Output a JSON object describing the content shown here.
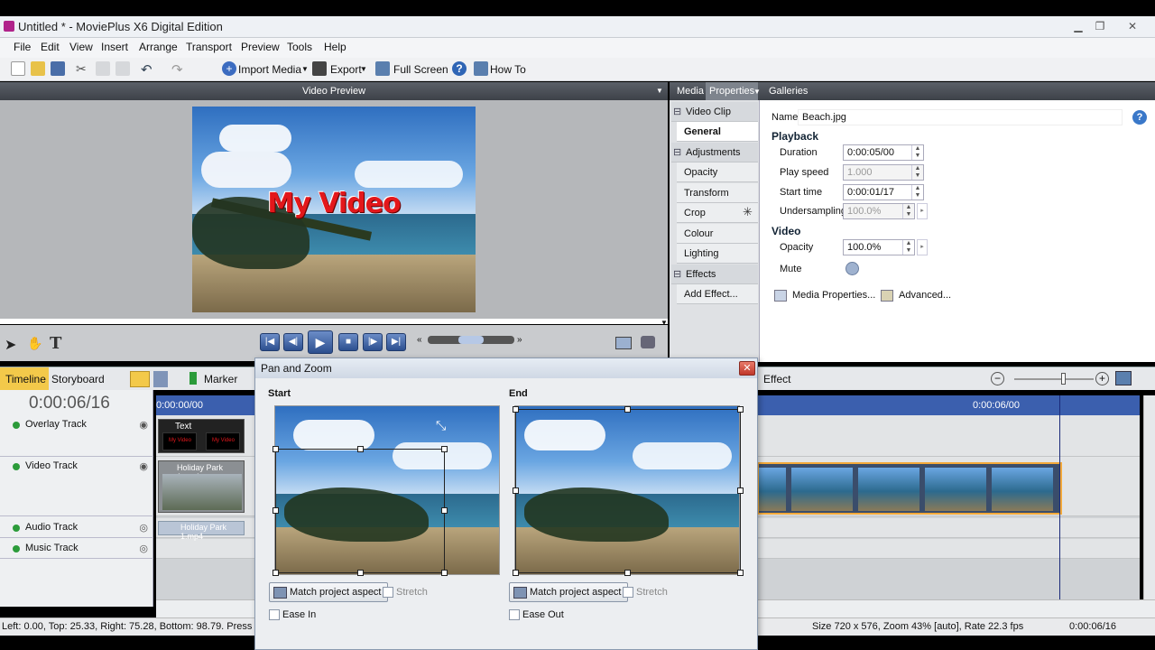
{
  "window": {
    "title": "Untitled * - MoviePlus X6 Digital Edition"
  },
  "menu": [
    "File",
    "Edit",
    "View",
    "Insert",
    "Arrange",
    "Transport",
    "Preview",
    "Tools",
    "Help"
  ],
  "toolbar": {
    "import_label": "Import Media",
    "export_label": "Export",
    "fullscreen_label": "Full Screen",
    "howto_label": "How To"
  },
  "preview": {
    "header": "Video Preview",
    "overlay_title": "My Video"
  },
  "right_panel": {
    "tabs": [
      "Media",
      "Properties",
      "Galleries"
    ],
    "active_tab": "Properties",
    "sidebar": {
      "video_clip": "Video Clip",
      "general": "General",
      "adjustments": "Adjustments",
      "adjust_items": [
        "Opacity",
        "Transform",
        "Crop",
        "Colour",
        "Lighting"
      ],
      "effects": "Effects",
      "add_effect": "Add Effect..."
    },
    "props": {
      "name_label": "Name",
      "name_value": "Beach.jpg",
      "playback_header": "Playback",
      "duration_label": "Duration",
      "duration_value": "0:00:05/00",
      "play_speed_label": "Play speed",
      "play_speed_value": "1.000",
      "start_time_label": "Start time",
      "start_time_value": "0:00:01/17",
      "undersampling_label": "Undersampling",
      "undersampling_value": "100.0%",
      "video_header": "Video",
      "opacity_label": "Opacity",
      "opacity_value": "100.0%",
      "mute_label": "Mute",
      "media_properties": "Media Properties...",
      "advanced": "Advanced..."
    }
  },
  "timeline": {
    "tabs": [
      "Timeline",
      "Storyboard"
    ],
    "marker_label": "Marker",
    "effect_label": "Effect",
    "current_time": "0:00:06/16",
    "ruler_start": "0:00:00/00",
    "ruler_mark": "0:00:06/00",
    "tracks": [
      "Overlay Track",
      "Video Track",
      "Audio Track",
      "Music Track"
    ],
    "overlay_clip_label": "Text",
    "overlay_clip_mini": "My Video",
    "video_clip_label": "Holiday Park 1.mp4",
    "audio_clip_label": "Holiday Park 1.mp4"
  },
  "pan_zoom": {
    "title": "Pan and Zoom",
    "start_label": "Start",
    "end_label": "End",
    "match_aspect": "Match project aspect",
    "stretch": "Stretch",
    "ease_in": "Ease In",
    "ease_out": "Ease Out"
  },
  "status": {
    "left": "Left: 0.00, Top: 25.33, Right: 75.28, Bottom: 98.79. Press A",
    "size": "Size 720 x 576, Zoom 43% [auto], Rate 22.3 fps",
    "time": "0:00:06/16"
  }
}
